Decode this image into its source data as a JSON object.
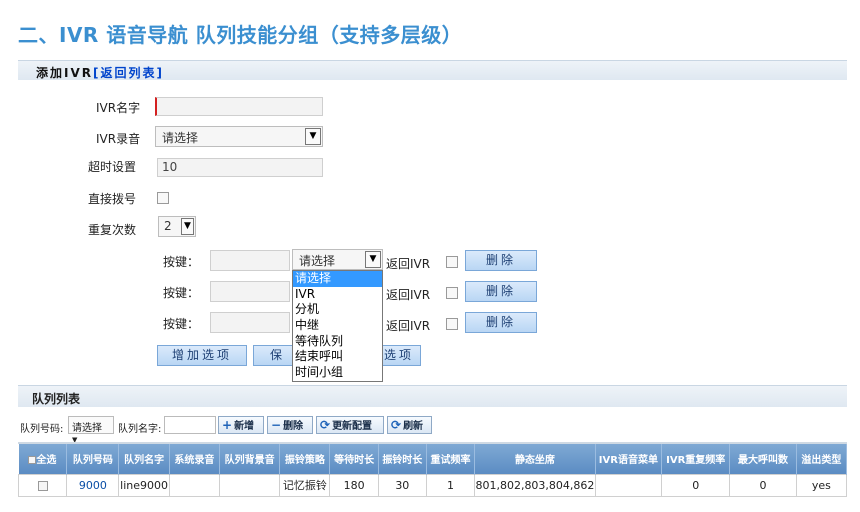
{
  "doc_title": "二、IVR 语音导航 队列技能分组（支持多层级）",
  "panel": {
    "title": "添加IVR",
    "back_link": "[返回列表]"
  },
  "form": {
    "ivr_name_label": "IVR名字",
    "ivr_name_value": "",
    "ivr_audio_label": "IVR录音",
    "ivr_audio_value": "请选择",
    "timeout_label": "超时设置",
    "timeout_value": "10",
    "direct_dial_label": "直接拨号",
    "repeat_label": "重复次数",
    "repeat_value": "2"
  },
  "key_rows": [
    {
      "label": "按键：",
      "select": "请选择",
      "return_label": "返回IVR",
      "delete_label": "删除"
    },
    {
      "label": "按键：",
      "select": "",
      "return_label": "返回IVR",
      "delete_label": "删除"
    },
    {
      "label": "按键：",
      "select": "",
      "return_label": "返回IVR",
      "delete_label": "删除"
    }
  ],
  "dropdown_options": [
    "请选择",
    "IVR",
    "分机",
    "中继",
    "等待队列",
    "结束呼叫",
    "时间小组"
  ],
  "actions": {
    "add_option": "增加选项",
    "save_partial": "保",
    "extra_partial": "选项"
  },
  "queue_panel": {
    "title": "队列列表",
    "toolbar": {
      "queue_no_label": "队列号码:",
      "queue_no_select": "请选择",
      "queue_name_label": "队列名字:",
      "add_btn": "新增",
      "delete_btn": "删除",
      "update_btn": "更新配置",
      "refresh_btn": "刷新"
    },
    "columns": [
      "全选",
      "队列号码",
      "队列名字",
      "系统录音",
      "队列背景音",
      "振铃策略",
      "等待时长",
      "振铃时长",
      "重试频率",
      "静态坐席",
      "IVR语音菜单",
      "IVR重复频率",
      "最大呼叫数",
      "溢出类型"
    ],
    "rows": [
      [
        "",
        "9000",
        "line9000",
        "",
        "",
        "记忆振铃",
        "180",
        "30",
        "1",
        "801,802,803,804,862",
        "",
        "0",
        "0",
        "yes"
      ]
    ]
  }
}
